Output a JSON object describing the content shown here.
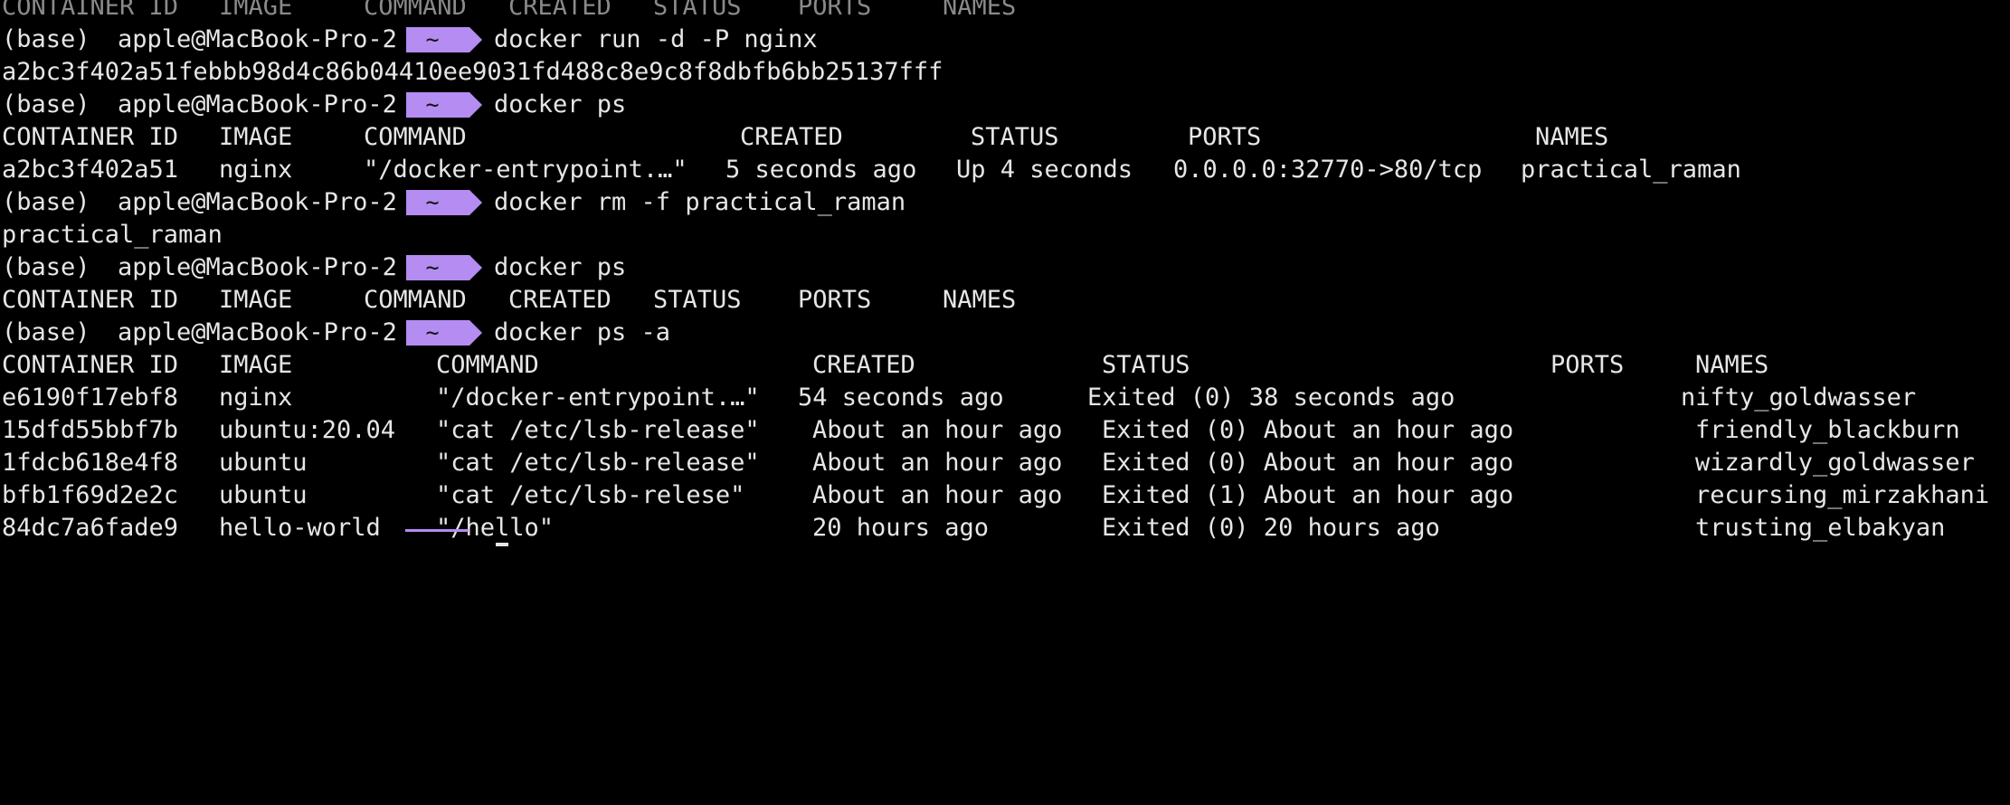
{
  "terminal": {
    "partial_header": [
      "CONTAINER ID",
      "IMAGE",
      "COMMAND",
      "CREATED",
      "STATUS",
      "PORTS",
      "NAMES"
    ],
    "prompt": {
      "env": "(base)",
      "user_host": "apple@MacBook-Pro-2",
      "dir": "~"
    },
    "commands": [
      "docker run -d -P nginx",
      "docker ps",
      "docker rm -f practical_raman",
      "docker ps",
      "docker ps -a"
    ],
    "outputs": {
      "run_id": "a2bc3f402a51febbb98d4c86b04410ee9031fd488c8e9c8f8dbfb6bb25137fff",
      "rm_result": "practical_raman"
    },
    "ps1": {
      "headers": [
        "CONTAINER ID",
        "IMAGE",
        "COMMAND",
        "CREATED",
        "STATUS",
        "PORTS",
        "NAMES"
      ],
      "rows": [
        [
          "a2bc3f402a51",
          "nginx",
          "\"/docker-entrypoint.…\"",
          "5 seconds ago",
          "Up 4 seconds",
          "0.0.0.0:32770->80/tcp",
          "practical_raman"
        ]
      ]
    },
    "ps2": {
      "headers": [
        "CONTAINER ID",
        "IMAGE",
        "COMMAND",
        "CREATED",
        "STATUS",
        "PORTS",
        "NAMES"
      ]
    },
    "ps_a": {
      "headers": [
        "CONTAINER ID",
        "IMAGE",
        "COMMAND",
        "CREATED",
        "STATUS",
        "PORTS",
        "NAMES"
      ],
      "rows": [
        [
          "e6190f17ebf8",
          "nginx",
          "\"/docker-entrypoint.…\"",
          "54 seconds ago",
          "Exited (0) 38 seconds ago",
          "",
          "nifty_goldwasser"
        ],
        [
          "15dfd55bbf7b",
          "ubuntu:20.04",
          "\"cat /etc/lsb-release\"",
          "About an hour ago",
          "Exited (0) About an hour ago",
          "",
          "friendly_blackburn"
        ],
        [
          "1fdcb618e4f8",
          "ubuntu",
          "\"cat /etc/lsb-release\"",
          "About an hour ago",
          "Exited (0) About an hour ago",
          "",
          "wizardly_goldwasser"
        ],
        [
          "bfb1f69d2e2c",
          "ubuntu",
          "\"cat /etc/lsb-relese\"",
          "About an hour ago",
          "Exited (1) About an hour ago",
          "",
          "recursing_mirzakhani"
        ],
        [
          "84dc7a6fade9",
          "hello-world",
          "\"/hello\"",
          "20 hours ago",
          "Exited (0) 20 hours ago",
          "",
          "trusting_elbakyan"
        ]
      ]
    },
    "colors": {
      "background": "#000000",
      "text": "#e6e6e6",
      "prompt_badge": "#b48cf2"
    }
  }
}
